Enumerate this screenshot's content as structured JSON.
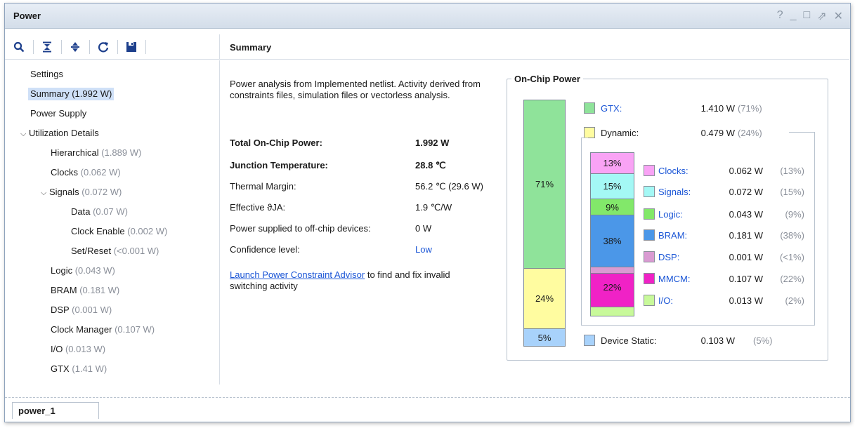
{
  "window": {
    "title": "Power",
    "controls": [
      "?",
      "_",
      "□",
      "⇗",
      "✕"
    ]
  },
  "toolbar": {
    "icons": [
      "search-icon",
      "collapse-all-icon",
      "expand-all-icon",
      "refresh-icon",
      "save-icon"
    ]
  },
  "tree": {
    "settings": "Settings",
    "summary": "Summary (1.992 W)",
    "power_supply": "Power Supply",
    "utilization": "Utilization Details",
    "hierarchical": {
      "label": "Hierarchical",
      "value": "(1.889 W)"
    },
    "clocks": {
      "label": "Clocks",
      "value": "(0.062 W)"
    },
    "signals": {
      "label": "Signals",
      "value": "(0.072 W)"
    },
    "data": {
      "label": "Data",
      "value": "(0.07 W)"
    },
    "clock_enable": {
      "label": "Clock Enable",
      "value": "(0.002 W)"
    },
    "set_reset": {
      "label": "Set/Reset",
      "value": "(<0.001 W)"
    },
    "logic": {
      "label": "Logic",
      "value": "(0.043 W)"
    },
    "bram": {
      "label": "BRAM",
      "value": "(0.181 W)"
    },
    "dsp": {
      "label": "DSP",
      "value": "(0.001 W)"
    },
    "clock_manager": {
      "label": "Clock Manager",
      "value": "(0.107 W)"
    },
    "io": {
      "label": "I/O",
      "value": "(0.013 W)"
    },
    "gtx": {
      "label": "GTX",
      "value": "(1.41 W)"
    }
  },
  "summary": {
    "heading": "Summary",
    "description": "Power analysis from Implemented netlist. Activity derived from constraints files, simulation files or vectorless analysis.",
    "rows": [
      {
        "label": "Total On-Chip Power:",
        "value": "1.992 W"
      },
      {
        "label": "Junction Temperature:",
        "value": "28.8 ℃"
      },
      {
        "label": "Thermal Margin:",
        "value": "56.2 ℃ (29.6 W)"
      },
      {
        "label": "Effective ϑJA:",
        "value": "1.9 ℃/W"
      },
      {
        "label": "Power supplied to off-chip devices:",
        "value": "0 W"
      },
      {
        "label": "Confidence level:",
        "value": "Low"
      }
    ],
    "advisor_link": "Launch Power Constraint Advisor",
    "advisor_rest": " to find and fix invalid switching activity"
  },
  "onchip": {
    "legend": "On-Chip Power",
    "main_bar": [
      {
        "label": "71%",
        "color": "#8fe39a"
      },
      {
        "label": "24%",
        "color": "#fffca0"
      },
      {
        "label": "5%",
        "color": "#a8d2fb"
      }
    ],
    "gtx": {
      "label": "GTX:",
      "value": "1.410 W",
      "pct": "(71%)",
      "color": "#8fe39a"
    },
    "dynamic": {
      "label": "Dynamic:",
      "value": "0.479 W",
      "pct": "(24%)",
      "color": "#fffca0"
    },
    "device_static": {
      "label": "Device Static:",
      "value": "0.103 W",
      "pct": "(5%)",
      "color": "#a8d2fb"
    },
    "dynamic_bar": [
      {
        "label": "13%",
        "color": "#f9a3f5"
      },
      {
        "label": "15%",
        "color": "#a4f8f5"
      },
      {
        "label": "9%",
        "color": "#82e86a"
      },
      {
        "label": "38%",
        "color": "#4b97e8"
      },
      {
        "label": "",
        "color": "#d99bd2"
      },
      {
        "label": "22%",
        "color": "#f022c6"
      },
      {
        "label": "",
        "color": "#c8f99a"
      }
    ],
    "dynamic_items": [
      {
        "label": "Clocks:",
        "value": "0.062 W",
        "pct": "(13%)",
        "color": "#f9a3f5"
      },
      {
        "label": "Signals:",
        "value": "0.072 W",
        "pct": "(15%)",
        "color": "#a4f8f5"
      },
      {
        "label": "Logic:",
        "value": "0.043 W",
        "pct": "(9%)",
        "color": "#82e86a"
      },
      {
        "label": "BRAM:",
        "value": "0.181 W",
        "pct": "(38%)",
        "color": "#4b97e8"
      },
      {
        "label": "DSP:",
        "value": "0.001 W",
        "pct": "(<1%)",
        "color": "#d99bd2"
      },
      {
        "label": "MMCM:",
        "value": "0.107 W",
        "pct": "(22%)",
        "color": "#f022c6"
      },
      {
        "label": "I/O:",
        "value": "0.013 W",
        "pct": "(2%)",
        "color": "#c8f99a"
      }
    ]
  },
  "bottom": {
    "tab": "power_1"
  }
}
